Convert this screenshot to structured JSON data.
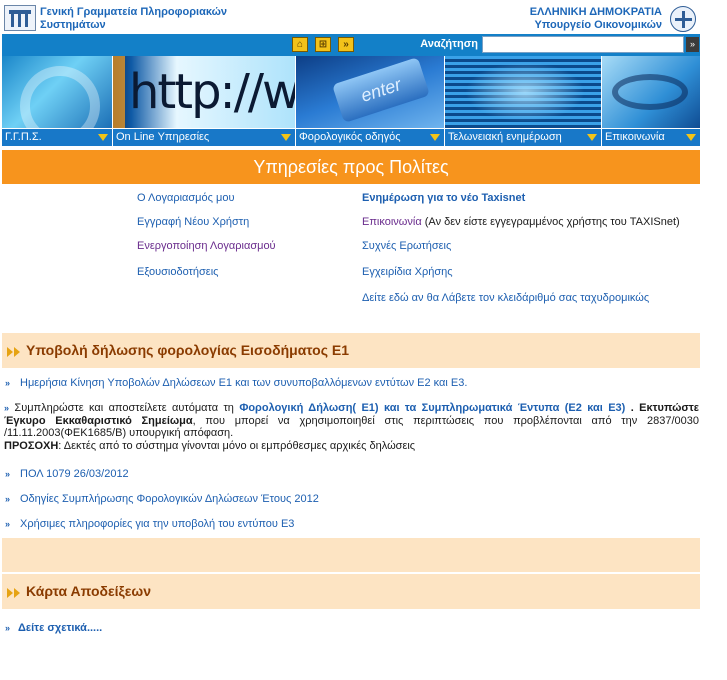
{
  "header": {
    "org_line1": "Γενική Γραμματεία Πληροφοριακών",
    "org_line2": "Συστημάτων",
    "country": "ΕΛΛΗΝΙΚΗ ΔΗΜΟΚΡΑΤΙΑ",
    "ministry": "Υπουργείο Οικονομικών"
  },
  "toolbar": {
    "icons": [
      "home-icon",
      "sitemap-icon",
      "forward-icon"
    ],
    "search_label": "Αναζήτηση",
    "search_value": "",
    "search_go": "»"
  },
  "banner": {
    "http_text": "http://www",
    "key_text": "enter"
  },
  "nav": [
    {
      "label": "Γ.Γ.Π.Σ."
    },
    {
      "label": "On Line Υπηρεσίες"
    },
    {
      "label": "Φορολογικός οδηγός"
    },
    {
      "label": "Τελωνειακή ενημέρωση"
    },
    {
      "label": "Επικοινωνία"
    }
  ],
  "services": {
    "title": "Υπηρεσίες προς Πολίτες",
    "left": [
      "Ο Λογαριασμός μου",
      "Εγγραφή Νέου Χρήστη",
      "Ενεργοποίηση Λογαριασμού",
      "Εξουσιοδοτήσεις"
    ],
    "right_news": "Ενημέρωση για το νέο Taxisnet",
    "right_contact": "Επικοινωνία",
    "right_contact_note": "(Αν δεν είστε εγγεγραμμένος χρήστης του TAXISnet)",
    "right_faq": "Συχνές Ερωτήσεις",
    "right_manuals": "Εγχειρίδια Χρήσης",
    "right_postal": "Δείτε εδώ αν θα Λάβετε τον κλειδάριθμό σας ταχυδρομικώς"
  },
  "e1": {
    "title": "Υποβολή δήλωσης φορολογίας Εισοδήματος Ε1",
    "daily_link": "Ημερήσια Κίνηση Υποβολών Δηλώσεων Ε1 και των συνυποβαλλόμενων εντύτων Ε2 και Ε3.",
    "para_prefix": "Συμπληρώστε και αποστείλετε αυτόματα τη",
    "para_link": "Φορολογική Δήλωση( Ε1) και τα Συμπληρωματικά Έντυπα (Ε2 και Ε3)",
    "para_mid1": ". Εκτυπώστε",
    "para_bold": "Έγκυρο Εκκαθαριστικό Σημείωμα",
    "para_mid2": ", που μπορεί να χρησιμοποιηθεί στις περιπτώσεις που προβλέπονται από την 2837/0030 /11.11.2003(ΦΕΚ1685/Β) υπουργική απόφαση.",
    "notice_label": "ΠΡΟΣΟΧΗ",
    "notice_text": ": Δεκτές από το σύστημα γίνονται μόνο οι εμπρόθεσμες αρχικές δηλώσεις",
    "links": [
      "ΠΟΛ 1079 26/03/2012",
      "Οδηγίες Συμπλήρωσης Φορολογικών Δηλώσεων Έτους 2012",
      "Χρήσιμες πληροφορίες για την υποβολή του εντύπου Ε3"
    ]
  },
  "receipts": {
    "title": "Κάρτα Αποδείξεων",
    "link": "Δείτε σχετικά....."
  },
  "colors": {
    "orange": "#f7941d",
    "nav_blue": "#1878c8",
    "link_blue": "#1d5fb0",
    "section_bg": "#fde4c3",
    "section_text": "#8a3b00"
  }
}
